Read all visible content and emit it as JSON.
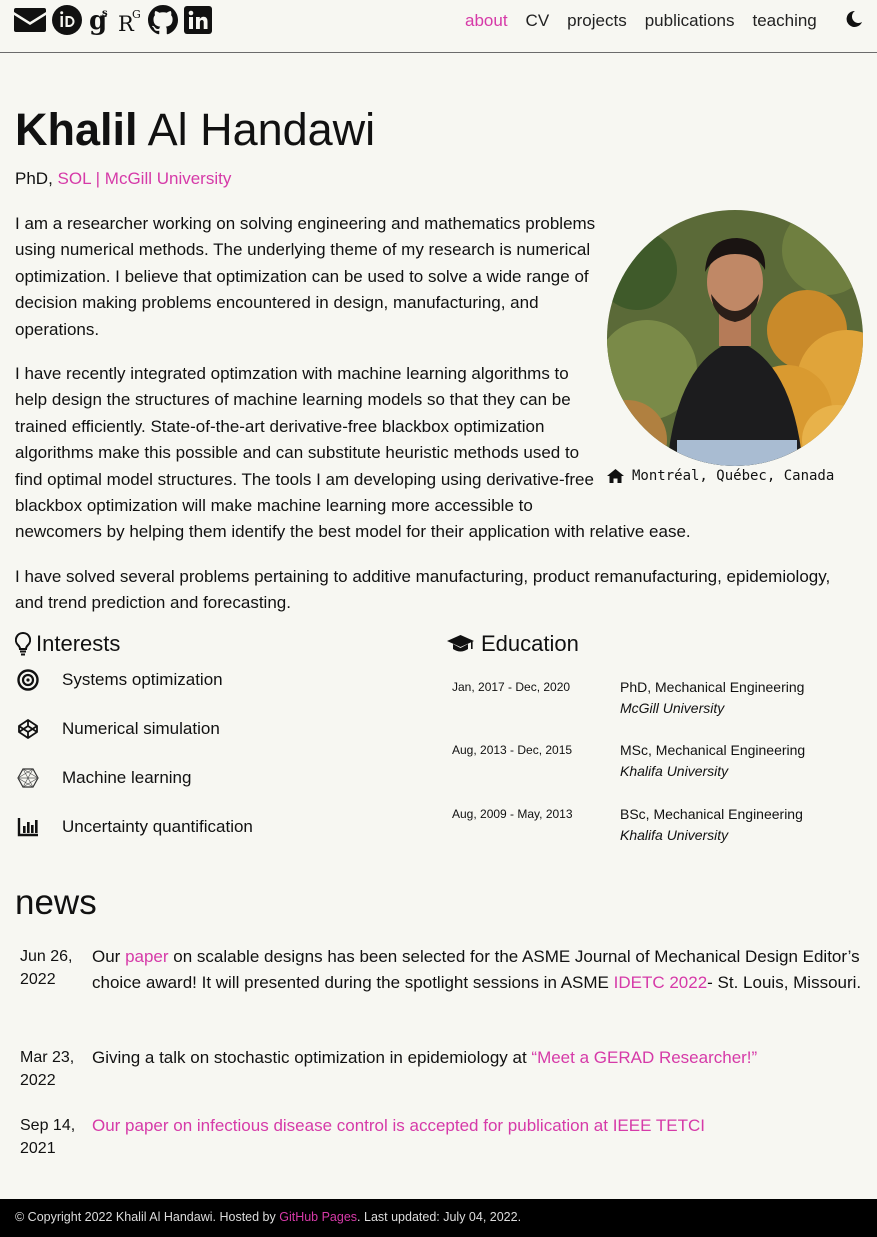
{
  "colors": {
    "accent": "#d63aa8",
    "background": "#f7f7f2",
    "footer_bg": "#000000"
  },
  "social_icons": [
    "envelope-icon",
    "orcid-icon",
    "google-scholar-icon",
    "researchgate-icon",
    "github-icon",
    "linkedin-icon"
  ],
  "nav": {
    "about": "about",
    "cv": "CV",
    "projects": "projects",
    "publications": "publications",
    "teaching": "teaching"
  },
  "profile": {
    "first_name": "Khalil",
    "last_name": "Al Handawi",
    "subtitle_prefix": "PhD,",
    "subtitle_link": "SOL | McGill University",
    "location": "Montréal, Québec, Canada"
  },
  "bio": [
    "I am a researcher working on solving engineering and mathematics problems using numerical methods. The underlying theme of my research is numerical optimization. I believe that optimization can be used to solve a wide range of decision making problems encountered in design, manufacturing, and operations.",
    "I have recently integrated optimzation with machine learning algorithms to help design the structures of machine learning models so that they can be trained efficiently. State-of-the-art derivative-free blackbox optimization algorithms make this possible and can substitute heuristic methods used to find optimal model structures. The tools I am developing using derivative-free blackbox optimization will make machine learning more accessible to newcomers by helping them identify the best model for their application with relative ease.",
    "I have solved several problems pertaining to additive manufacturing, product remanufacturing, epidemiology, and trend prediction and forecasting."
  ],
  "interests": {
    "title": "Interests",
    "items": [
      {
        "label": "Systems optimization",
        "icon": "target-icon"
      },
      {
        "label": "Numerical simulation",
        "icon": "codepen-icon"
      },
      {
        "label": "Machine learning",
        "icon": "network-icon"
      },
      {
        "label": "Uncertainty quantification",
        "icon": "bar-chart-icon"
      }
    ]
  },
  "education": {
    "title": "Education",
    "items": [
      {
        "date": "Jan, 2017 - Dec, 2020",
        "degree": "PhD, Mechanical Engineering",
        "institution": "McGill University"
      },
      {
        "date": "Aug, 2013 - Dec, 2015",
        "degree": "MSc, Mechanical Engineering",
        "institution": "Khalifa University"
      },
      {
        "date": "Aug, 2009 - May, 2013",
        "degree": "BSc, Mechanical Engineering",
        "institution": "Khalifa University"
      }
    ]
  },
  "news": {
    "title": "news",
    "items": [
      {
        "date_line1": "Jun 26,",
        "date_line2": "2022",
        "t1": "Our ",
        "link1": "paper",
        "t2": " on scalable designs has been selected for the ASME Journal of Mechanical Design Editor’s choice award! It will presented during the spotlight sessions in ASME ",
        "link2": "IDETC 2022",
        "t3": "- St. Louis, Missouri."
      },
      {
        "date_line1": "Mar 23,",
        "date_line2": "2022",
        "t1": "Giving a talk on stochastic optimization in epidemiology at ",
        "link1": "“Meet a GERAD Researcher!”"
      },
      {
        "date_line1": "Sep 14,",
        "date_line2": "2021",
        "link1": "Our paper on infectious disease control is accepted for publication at IEEE TETCI"
      }
    ]
  },
  "footer": {
    "t1": "© Copyright 2022 Khalil Al Handawi. Hosted by ",
    "link": "GitHub Pages",
    "t2": ". Last updated: July 04, 2022."
  }
}
